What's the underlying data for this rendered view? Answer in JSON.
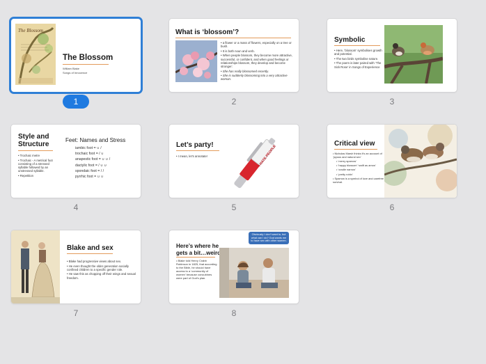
{
  "slides": [
    {
      "number": "1",
      "title": "The Blossom",
      "sub1": "William Blake",
      "sub2": "Songs of Innocence",
      "plate_text": "The Blossom"
    },
    {
      "number": "2",
      "title": "What is ‘blossom’?",
      "b1": "a flower or a mass of flowers, especially on a tree or bush.",
      "b2": "It is both noun and verb.",
      "b3": "When people blossom, they become more attractive, successful, or confident, and when good feelings or relationships blossom, they develop and become stronger:",
      "b4": "She has really blossomed recently.",
      "b5": "She is suddenly blossoming into a very attractive woman."
    },
    {
      "number": "3",
      "title": "Symbolic",
      "b1": "Here, ‘blossom’ symbolises growth and potential.",
      "b2": "The two birds symbolise nature.",
      "b3": "The poem is later paired with ‘The Sick Rose’ in Songs of Experience"
    },
    {
      "number": "4",
      "title": "Style and Structure",
      "b1": "Trochaic metre",
      "b2": "Trochaic - A metrical foot consisting of a stressed syllable followed by an unstressed syllable.",
      "b3": "Repetition",
      "feet_title": "Feet: Names and Stress",
      "feet": [
        "iambic foot = ∪ /",
        "trochaic foot = / ∪",
        "anapestic foot = ∪ ∪ /",
        "dactylic foot = / ∪ ∪",
        "spondaic foot = / /",
        "pyrrhic foot = ∪ ∪"
      ]
    },
    {
      "number": "5",
      "title": "Let’s party!",
      "b1": "I mean, let’s annotate!",
      "pen_text": "I HATE PEOPLE"
    },
    {
      "number": "6",
      "title": "Critical view",
      "b1": "Nicholas Marsh thinks it’s an account of ‘joyous and natural sex’",
      "s1": "‘merry sparrow’",
      "s2": "‘happy blossom’ ‘swift as arrow’",
      "s3": "‘cradle narrow’",
      "s4": "‘pretty robin’",
      "b2": "Sparrow is a symbol of love and carefree survival."
    },
    {
      "number": "7",
      "title": "Blake and sex",
      "b1": "Blake had progressive views about sex.",
      "b2": "He even thought the older generation socially confined children to a specific gender role.",
      "b3": "He saw this as chopping off their wings and sexual freedom."
    },
    {
      "number": "8",
      "title": "Here’s where he gets a bit…weird",
      "b1": "Blake told Henry Crabb Robinson in 1825, that according to the Bible, he should have access to a ‘community of women’ because concubines were part of God’s plan.",
      "bubble": "Obviously I don’t want to, but what can I do? God wants me to have sex with other women."
    }
  ],
  "colors": {
    "selection": "#2f7fd6",
    "badge": "#1f7ae0",
    "accent_rule": "#e39a5a",
    "background": "#e4e4e6"
  }
}
